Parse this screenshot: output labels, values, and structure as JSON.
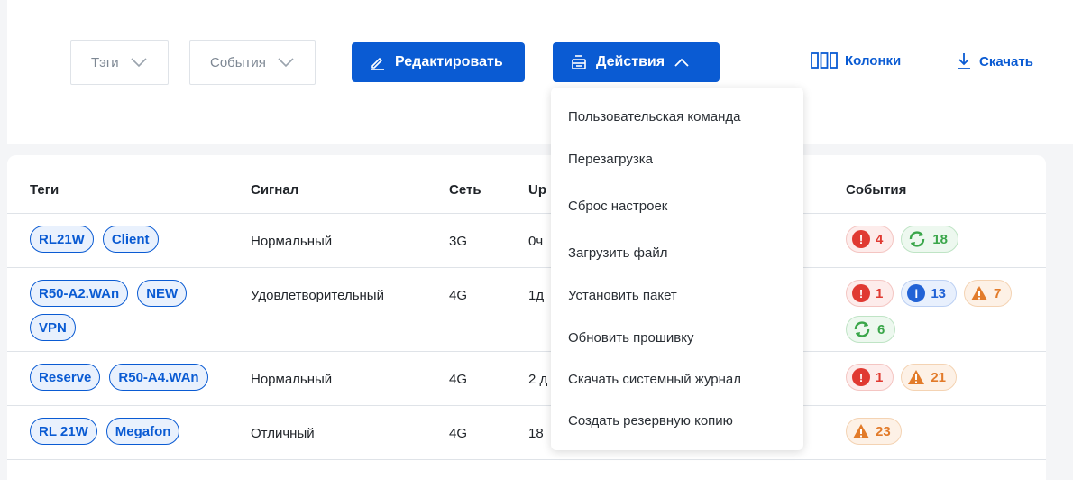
{
  "toolbar": {
    "tags_filter": "Тэги",
    "events_filter": "События",
    "edit_button": "Редактировать",
    "actions_button": "Действия",
    "columns_button": "Колонки",
    "download_button": "Скачать"
  },
  "table": {
    "headers": {
      "tags": "Теги",
      "signal": "Сигнал",
      "network": "Сеть",
      "uptime": "Up",
      "events": "События"
    },
    "rows": [
      {
        "tags": [
          "RL21W",
          "Client"
        ],
        "signal": "Нормальный",
        "network": "3G",
        "uptime": "0ч",
        "events": [
          {
            "kind": "error",
            "count": "4"
          },
          {
            "kind": "sync",
            "count": "18"
          }
        ]
      },
      {
        "tags": [
          "R50-A2.WAn",
          "NEW",
          "VPN"
        ],
        "signal": "Удовлетворительный",
        "network": "4G",
        "uptime": "1д",
        "events": [
          {
            "kind": "error",
            "count": "1"
          },
          {
            "kind": "info",
            "count": "13"
          },
          {
            "kind": "warning",
            "count": "7"
          },
          {
            "kind": "sync",
            "count": "6"
          }
        ]
      },
      {
        "tags": [
          "Reserve",
          "R50-A4.WAn"
        ],
        "signal": "Нормальный",
        "network": "4G",
        "uptime": "2 д",
        "events": [
          {
            "kind": "error",
            "count": "1"
          },
          {
            "kind": "warning",
            "count": "21"
          }
        ]
      },
      {
        "tags": [
          "RL 21W",
          "Megafon"
        ],
        "signal": "Отличный",
        "network": "4G",
        "uptime": "18",
        "events": [
          {
            "kind": "warning",
            "count": "23"
          }
        ]
      }
    ]
  },
  "actions_menu": [
    "Пользовательская команда",
    "Перезагрузка",
    "Сброс настроек",
    "Загрузить файл",
    "Установить пакет",
    "Обновить прошивку",
    "Скачать системный журнал",
    "Создать резервную копию"
  ],
  "colors": {
    "primary": "#0a5bd3",
    "error": "#e03a32",
    "sync": "#3aa64a",
    "info": "#2263d6",
    "warning": "#e27b2a"
  }
}
